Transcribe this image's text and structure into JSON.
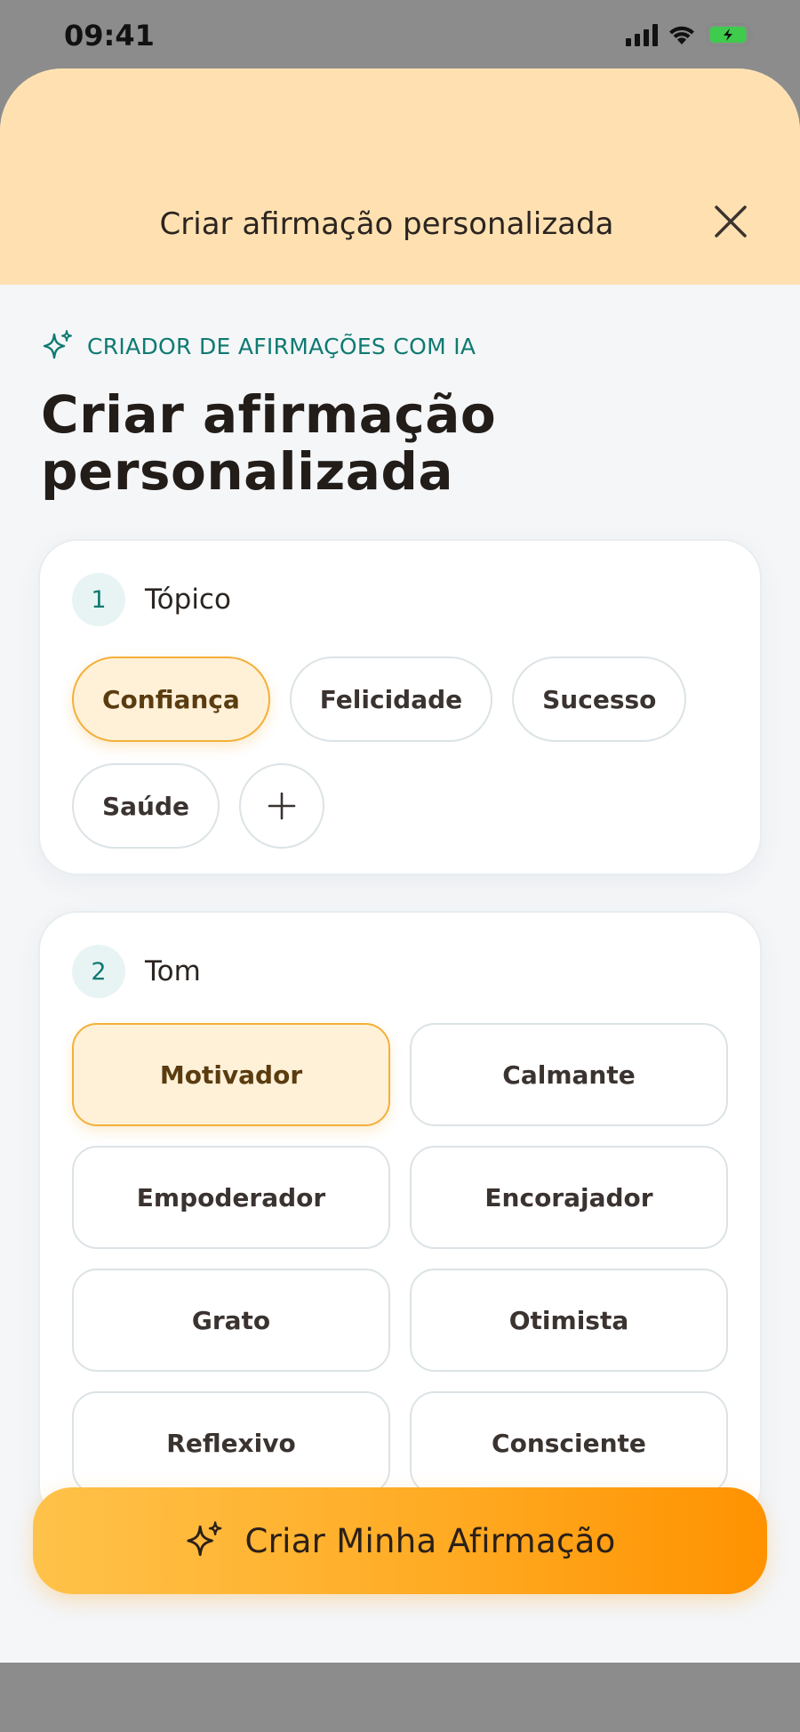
{
  "status_bar": {
    "time": "09:41"
  },
  "header": {
    "title": "Criar afirmação personalizada"
  },
  "eyebrow": {
    "label": "CRIADOR DE AFIRMAÇÕES COM IA"
  },
  "page": {
    "title_line1": "Criar afirmação",
    "title_line2": "personalizada"
  },
  "topic": {
    "step": "1",
    "label": "Tópico",
    "chips": [
      {
        "label": "Confiança",
        "selected": true
      },
      {
        "label": "Felicidade",
        "selected": false
      },
      {
        "label": "Sucesso",
        "selected": false
      },
      {
        "label": "Saúde",
        "selected": false
      }
    ],
    "add_icon": "plus-icon"
  },
  "tone": {
    "step": "2",
    "label": "Tom",
    "options": [
      {
        "label": "Motivador",
        "selected": true
      },
      {
        "label": "Calmante",
        "selected": false
      },
      {
        "label": "Empoderador",
        "selected": false
      },
      {
        "label": "Encorajador",
        "selected": false
      },
      {
        "label": "Grato",
        "selected": false
      },
      {
        "label": "Otimista",
        "selected": false
      },
      {
        "label": "Reflexivo",
        "selected": false
      },
      {
        "label": "Consciente",
        "selected": false
      }
    ]
  },
  "cta": {
    "label": "Criar Minha Afirmação",
    "icon": "sparkles-icon"
  },
  "colors": {
    "header_bg": "#ffe1b1",
    "accent_teal": "#0f7a72",
    "selected_bg": "#fff1d8",
    "selected_border": "#f3b03a",
    "cta_start": "#ffc24a",
    "cta_end": "#ff9200"
  }
}
